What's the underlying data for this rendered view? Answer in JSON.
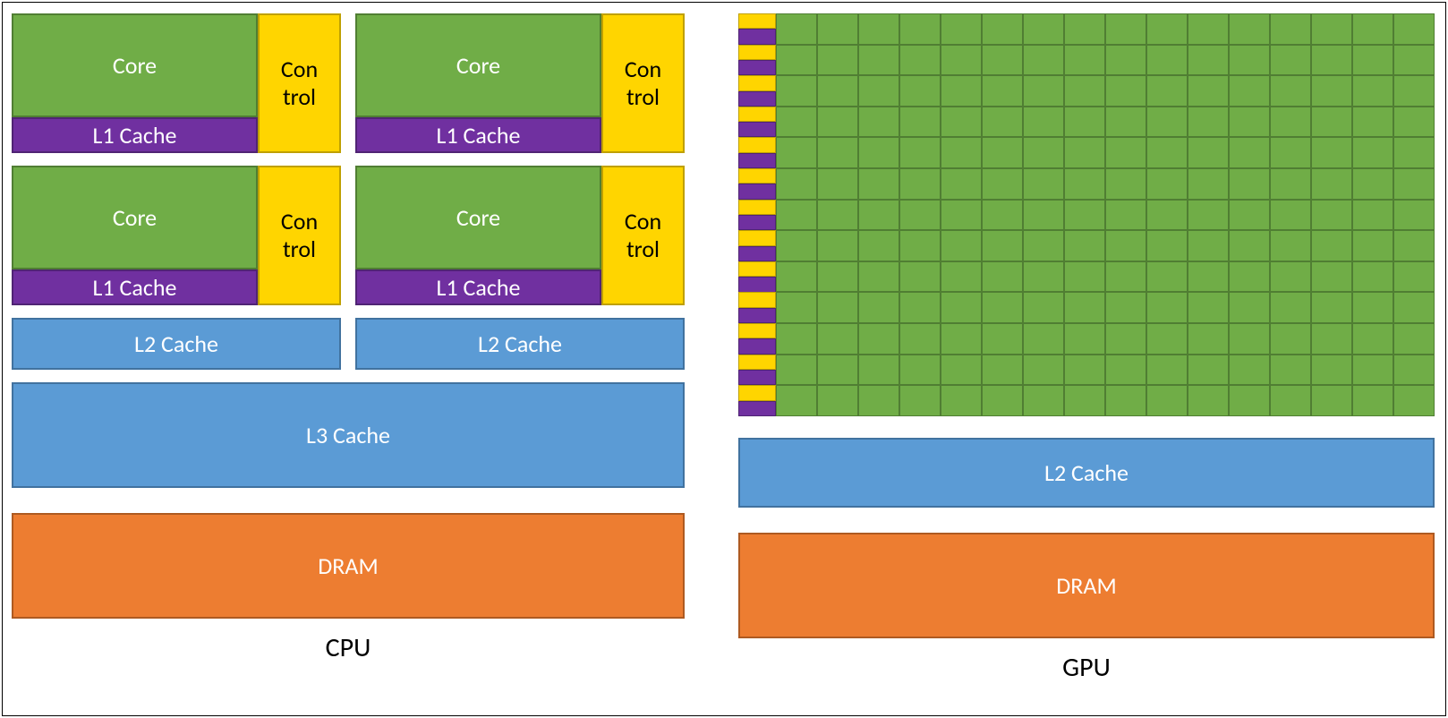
{
  "cpu": {
    "core_label": "Core",
    "control_label": "Con\ntrol",
    "l1_label": "L1 Cache",
    "l2_label": "L2 Cache",
    "l3_label": "L3 Cache",
    "dram_label": "DRAM",
    "title": "CPU"
  },
  "gpu": {
    "rows": 13,
    "cols": 16,
    "l2_label": "L2 Cache",
    "dram_label": "DRAM",
    "title": "GPU"
  },
  "colors": {
    "core": "#70AD47",
    "control": "#FFD500",
    "l1": "#7030A0",
    "cache": "#5B9BD5",
    "dram": "#ED7D31"
  }
}
